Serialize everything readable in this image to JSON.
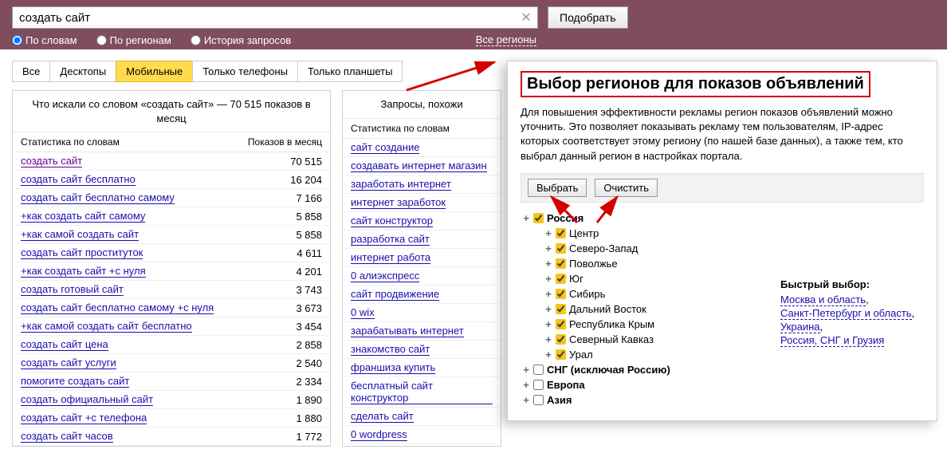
{
  "search": {
    "value": "создать сайт",
    "submit": "Подобрать"
  },
  "radios": {
    "words": "По словам",
    "regions": "По регионам",
    "history": "История запросов"
  },
  "regions_link": "Все регионы",
  "tabs": {
    "all": "Все",
    "desktops": "Десктопы",
    "mobile": "Мобильные",
    "phones": "Только телефоны",
    "tablets": "Только планшеты"
  },
  "left": {
    "header": "Что искали со словом «создать сайт» — 70 515 показов в месяц",
    "th1": "Статистика по словам",
    "th2": "Показов в месяц",
    "rows": [
      {
        "word": "создать сайт",
        "count": "70 515",
        "visited": true
      },
      {
        "word": "создать сайт бесплатно",
        "count": "16 204"
      },
      {
        "word": "создать сайт бесплатно самому",
        "count": "7 166"
      },
      {
        "word": "+как создать сайт самому",
        "count": "5 858"
      },
      {
        "word": "+как самой создать сайт",
        "count": "5 858"
      },
      {
        "word": "создать сайт проституток",
        "count": "4 611"
      },
      {
        "word": "+как создать сайт +с нуля",
        "count": "4 201"
      },
      {
        "word": "создать готовый сайт",
        "count": "3 743"
      },
      {
        "word": "создать сайт бесплатно самому +с нуля",
        "count": "3 673"
      },
      {
        "word": "+как самой создать сайт бесплатно",
        "count": "3 454"
      },
      {
        "word": "создать сайт цена",
        "count": "2 858"
      },
      {
        "word": "создать сайт услуги",
        "count": "2 540"
      },
      {
        "word": "помогите создать сайт",
        "count": "2 334"
      },
      {
        "word": "создать официальный сайт",
        "count": "1 890"
      },
      {
        "word": "создать сайт +с телефона",
        "count": "1 880"
      },
      {
        "word": "создать сайт часов",
        "count": "1 772"
      }
    ]
  },
  "right": {
    "header": "Запросы, похожи",
    "th1": "Статистика по словам",
    "rows": [
      {
        "word": "сайт создание"
      },
      {
        "word": "создавать интернет магазин"
      },
      {
        "word": "заработать интернет"
      },
      {
        "word": "интернет заработок"
      },
      {
        "word": "сайт конструктор"
      },
      {
        "word": "разработка сайт"
      },
      {
        "word": "интернет работа"
      },
      {
        "word": "0 алиэкспресс"
      },
      {
        "word": "сайт продвижение"
      },
      {
        "word": "0 wix"
      },
      {
        "word": "зарабатывать интернет"
      },
      {
        "word": "знакомство сайт"
      },
      {
        "word": "франшиза купить"
      },
      {
        "word": "бесплатный сайт конструктор"
      },
      {
        "word": "сделать сайт"
      },
      {
        "word": "0 wordpress"
      }
    ]
  },
  "popup": {
    "title": "Выбор регионов для показов объявлений",
    "desc": "Для повышения эффективности рекламы регион показов объявлений можно уточнить. Это позволяет показывать рекламу тем пользователям, IP-адрес которых соответствует этому региону (по нашей базе данных), а также тем, кто выбрал данный регион в настройках портала.",
    "select_btn": "Выбрать",
    "clear_btn": "Очистить",
    "quick_title": "Быстрый выбор:",
    "quick_links": [
      "Москва и область",
      "Санкт-Петербург и область",
      "Украина",
      "Россия, СНГ и Грузия"
    ],
    "tree": {
      "russia": "Россия",
      "children": [
        "Центр",
        "Северо-Запад",
        "Поволжье",
        "Юг",
        "Сибирь",
        "Дальний Восток",
        "Республика Крым",
        "Северный Кавказ",
        "Урал"
      ],
      "others": [
        "СНГ (исключая Россию)",
        "Европа",
        "Азия"
      ]
    }
  }
}
